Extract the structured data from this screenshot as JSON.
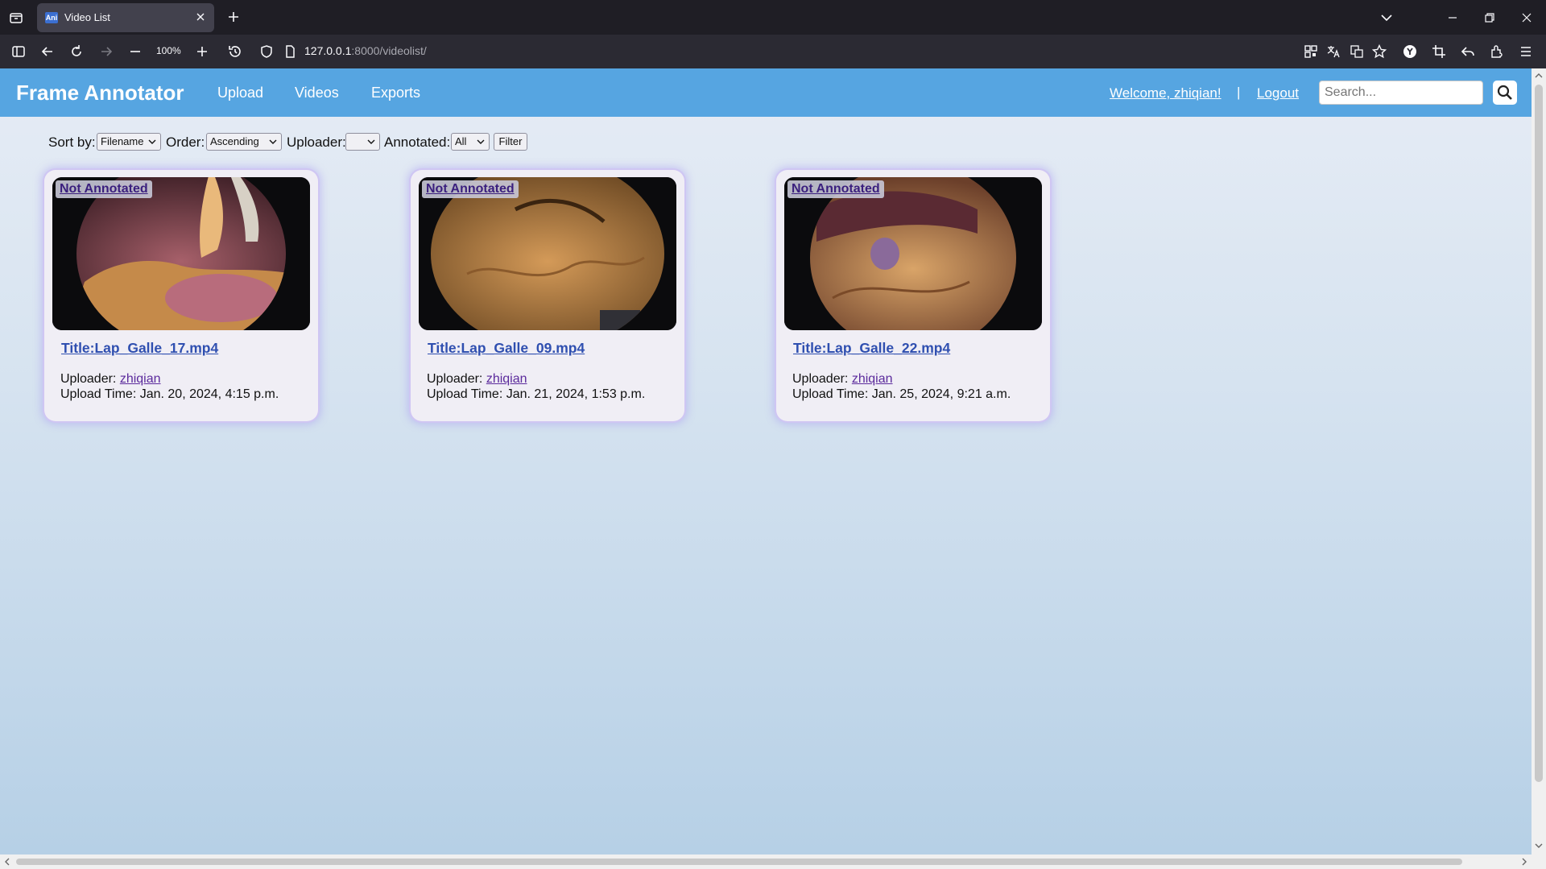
{
  "browser": {
    "tab_title": "Video List",
    "tab_favicon_text": "Ani",
    "zoom": "100%",
    "url_host": "127.0.0.1",
    "url_rest": ":8000/videolist/"
  },
  "header": {
    "brand": "Frame Annotator",
    "nav": [
      "Upload",
      "Videos",
      "Exports"
    ],
    "welcome": "Welcome, zhiqian!",
    "separator": "|",
    "logout": "Logout",
    "search_placeholder": "Search..."
  },
  "filters": {
    "sort_label": "Sort by:",
    "sort_value": "Filename",
    "order_label": "Order:",
    "order_value": "Ascending",
    "uploader_label": "Uploader:",
    "uploader_value": "",
    "annotated_label": "Annotated:",
    "annotated_value": "All",
    "filter_button": "Filter"
  },
  "videos": [
    {
      "badge": "Not Annotated",
      "title": "Title:Lap_Galle_17.mp4",
      "uploader_label": "Uploader:",
      "uploader": "zhiqian",
      "upload_time": "Upload Time: Jan. 20, 2024, 4:15 p.m."
    },
    {
      "badge": "Not Annotated",
      "title": "Title:Lap_Galle_09.mp4",
      "uploader_label": "Uploader:",
      "uploader": "zhiqian",
      "upload_time": "Upload Time: Jan. 21, 2024, 1:53 p.m."
    },
    {
      "badge": "Not Annotated",
      "title": "Title:Lap_Galle_22.mp4",
      "uploader_label": "Uploader:",
      "uploader": "zhiqian",
      "upload_time": "Upload Time: Jan. 25, 2024, 9:21 a.m."
    }
  ],
  "colors": {
    "header_bg": "#56a5e1",
    "card_glow": "#cfc6f3",
    "title_link": "#2f4fb0"
  }
}
